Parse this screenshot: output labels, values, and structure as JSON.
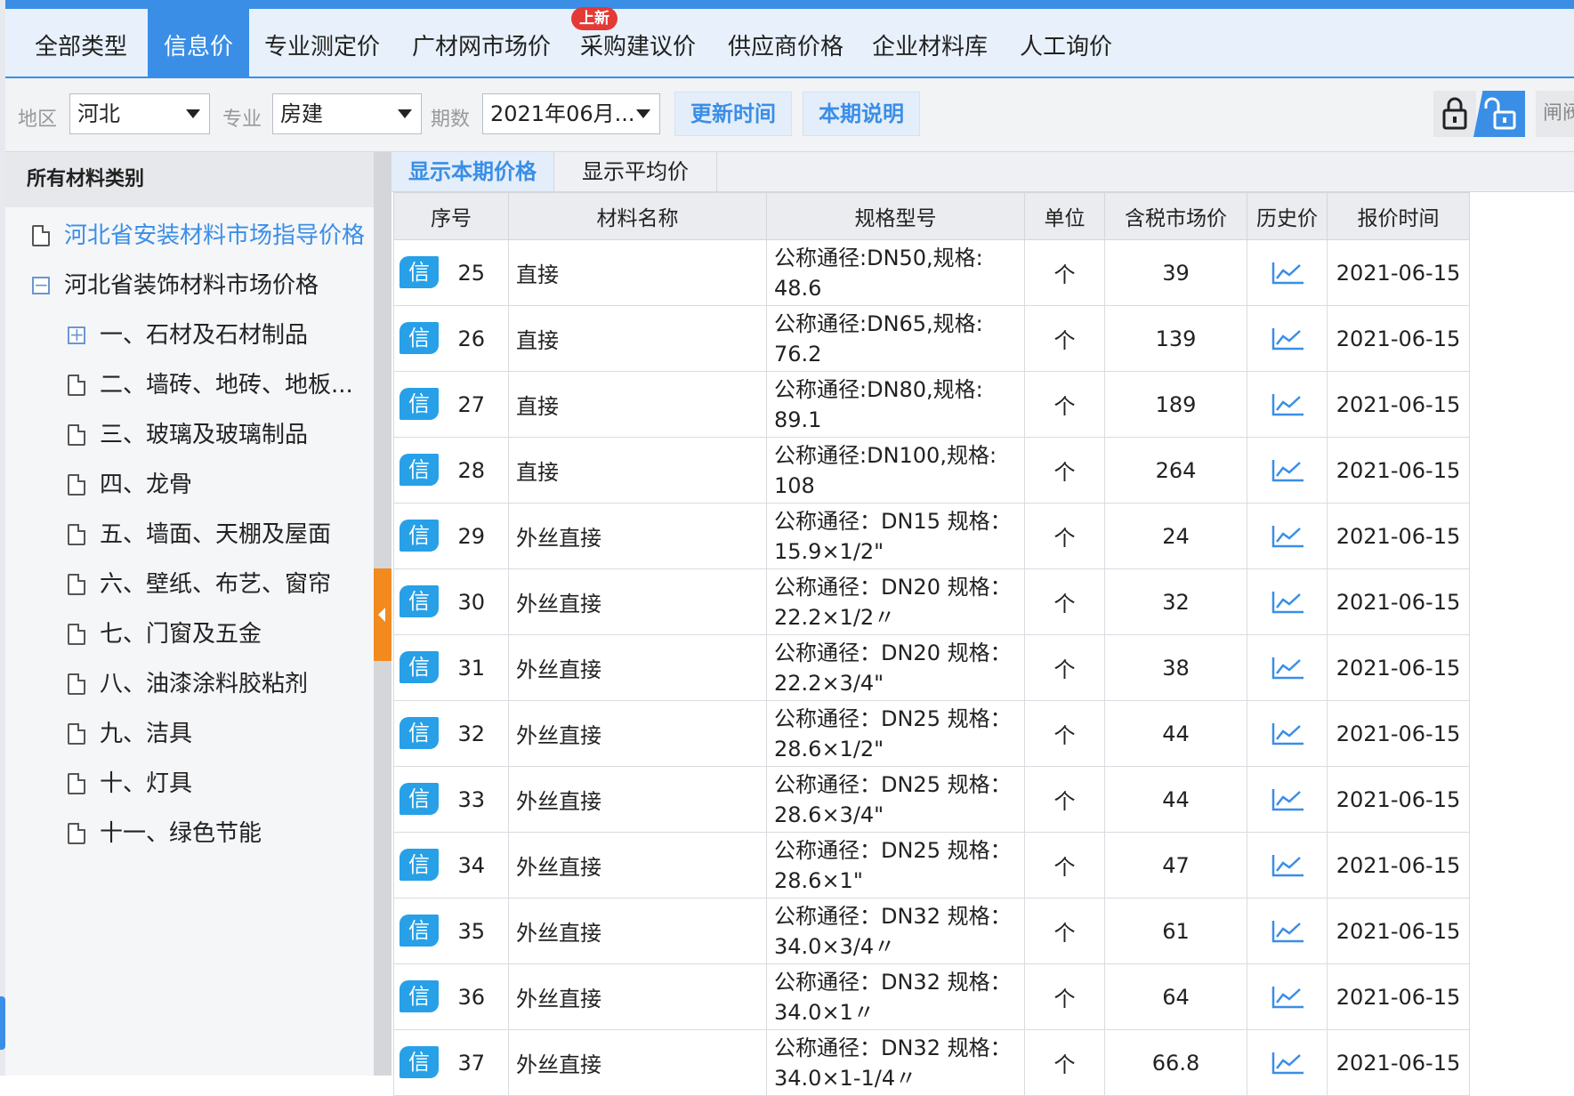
{
  "top_tabs": [
    {
      "label": "全部类型"
    },
    {
      "label": "信息价",
      "active": true
    },
    {
      "label": "专业测定价"
    },
    {
      "label": "广材网市场价"
    },
    {
      "label": "采购建议价",
      "badge": "上新"
    },
    {
      "label": "供应商价格"
    },
    {
      "label": "企业材料库"
    },
    {
      "label": "人工询价"
    }
  ],
  "filters": {
    "region_label": "地区",
    "region_value": "河北",
    "major_label": "专业",
    "major_value": "房建",
    "period_label": "期数",
    "period_value": "2021年06月...",
    "update_time_btn": "更新时间",
    "period_note_btn": "本期说明",
    "tail_btn": "闸阀"
  },
  "sidebar": {
    "title": "所有材料类别",
    "items": [
      {
        "label": "河北省安装材料市场指导价格",
        "icon": "doc",
        "level": 0,
        "link": true
      },
      {
        "label": "河北省装饰材料市场价格",
        "icon": "collapse",
        "level": 0
      },
      {
        "label": "一、石材及石材制品",
        "icon": "expand",
        "level": 1
      },
      {
        "label": "二、墙砖、地砖、地板...",
        "icon": "doc",
        "level": 1
      },
      {
        "label": "三、玻璃及玻璃制品",
        "icon": "doc",
        "level": 1
      },
      {
        "label": "四、龙骨",
        "icon": "doc",
        "level": 1
      },
      {
        "label": "五、墙面、天棚及屋面",
        "icon": "doc",
        "level": 1
      },
      {
        "label": "六、壁纸、布艺、窗帘",
        "icon": "doc",
        "level": 1
      },
      {
        "label": "七、门窗及五金",
        "icon": "doc",
        "level": 1
      },
      {
        "label": "八、油漆涂料胶粘剂",
        "icon": "doc",
        "level": 1
      },
      {
        "label": "九、洁具",
        "icon": "doc",
        "level": 1
      },
      {
        "label": "十、灯具",
        "icon": "doc",
        "level": 1
      },
      {
        "label": "十一、绿色节能",
        "icon": "doc",
        "level": 1
      }
    ]
  },
  "sub_tabs": [
    {
      "label": "显示本期价格",
      "active": true
    },
    {
      "label": "显示平均价"
    }
  ],
  "table": {
    "badge": "信",
    "columns": [
      "序号",
      "材料名称",
      "规格型号",
      "单位",
      "含税市场价",
      "历史价",
      "报价时间"
    ],
    "rows": [
      {
        "no": "25",
        "name": "直接",
        "spec": "公称通径:DN50,规格:\n48.6",
        "unit": "个",
        "price": "39",
        "date": "2021-06-15"
      },
      {
        "no": "26",
        "name": "直接",
        "spec": "公称通径:DN65,规格:\n76.2",
        "unit": "个",
        "price": "139",
        "date": "2021-06-15"
      },
      {
        "no": "27",
        "name": "直接",
        "spec": "公称通径:DN80,规格:\n89.1",
        "unit": "个",
        "price": "189",
        "date": "2021-06-15"
      },
      {
        "no": "28",
        "name": "直接",
        "spec": "公称通径:DN100,规格:\n108",
        "unit": "个",
        "price": "264",
        "date": "2021-06-15"
      },
      {
        "no": "29",
        "name": "外丝直接",
        "spec": "公称通径：DN15 规格：\n15.9×1/2\"",
        "unit": "个",
        "price": "24",
        "date": "2021-06-15"
      },
      {
        "no": "30",
        "name": "外丝直接",
        "spec": "公称通径：DN20 规格：\n22.2×1/2〃",
        "unit": "个",
        "price": "32",
        "date": "2021-06-15"
      },
      {
        "no": "31",
        "name": "外丝直接",
        "spec": "公称通径：DN20 规格：\n22.2×3/4\"",
        "unit": "个",
        "price": "38",
        "date": "2021-06-15"
      },
      {
        "no": "32",
        "name": "外丝直接",
        "spec": "公称通径：DN25 规格：\n28.6×1/2\"",
        "unit": "个",
        "price": "44",
        "date": "2021-06-15"
      },
      {
        "no": "33",
        "name": "外丝直接",
        "spec": "公称通径：DN25 规格：\n28.6×3/4\"",
        "unit": "个",
        "price": "44",
        "date": "2021-06-15"
      },
      {
        "no": "34",
        "name": "外丝直接",
        "spec": "公称通径：DN25 规格：\n28.6×1\"",
        "unit": "个",
        "price": "47",
        "date": "2021-06-15"
      },
      {
        "no": "35",
        "name": "外丝直接",
        "spec": "公称通径：DN32 规格：\n34.0×3/4〃",
        "unit": "个",
        "price": "61",
        "date": "2021-06-15"
      },
      {
        "no": "36",
        "name": "外丝直接",
        "spec": "公称通径：DN32 规格：\n34.0×1〃",
        "unit": "个",
        "price": "64",
        "date": "2021-06-15"
      },
      {
        "no": "37",
        "name": "外丝直接",
        "spec": "公称通径：DN32 规格：\n34.0×1-1/4〃",
        "unit": "个",
        "price": "66.8",
        "date": "2021-06-15"
      }
    ]
  },
  "colors": {
    "accent": "#3a8ee6",
    "badge": "#27a0e8",
    "grip": "#f38a1e",
    "new_badge": "#e53935"
  },
  "icons": {
    "history": "line-chart-icon",
    "lock": "lock-icon",
    "unlock": "unlock-icon",
    "tree_doc": "document-icon"
  }
}
